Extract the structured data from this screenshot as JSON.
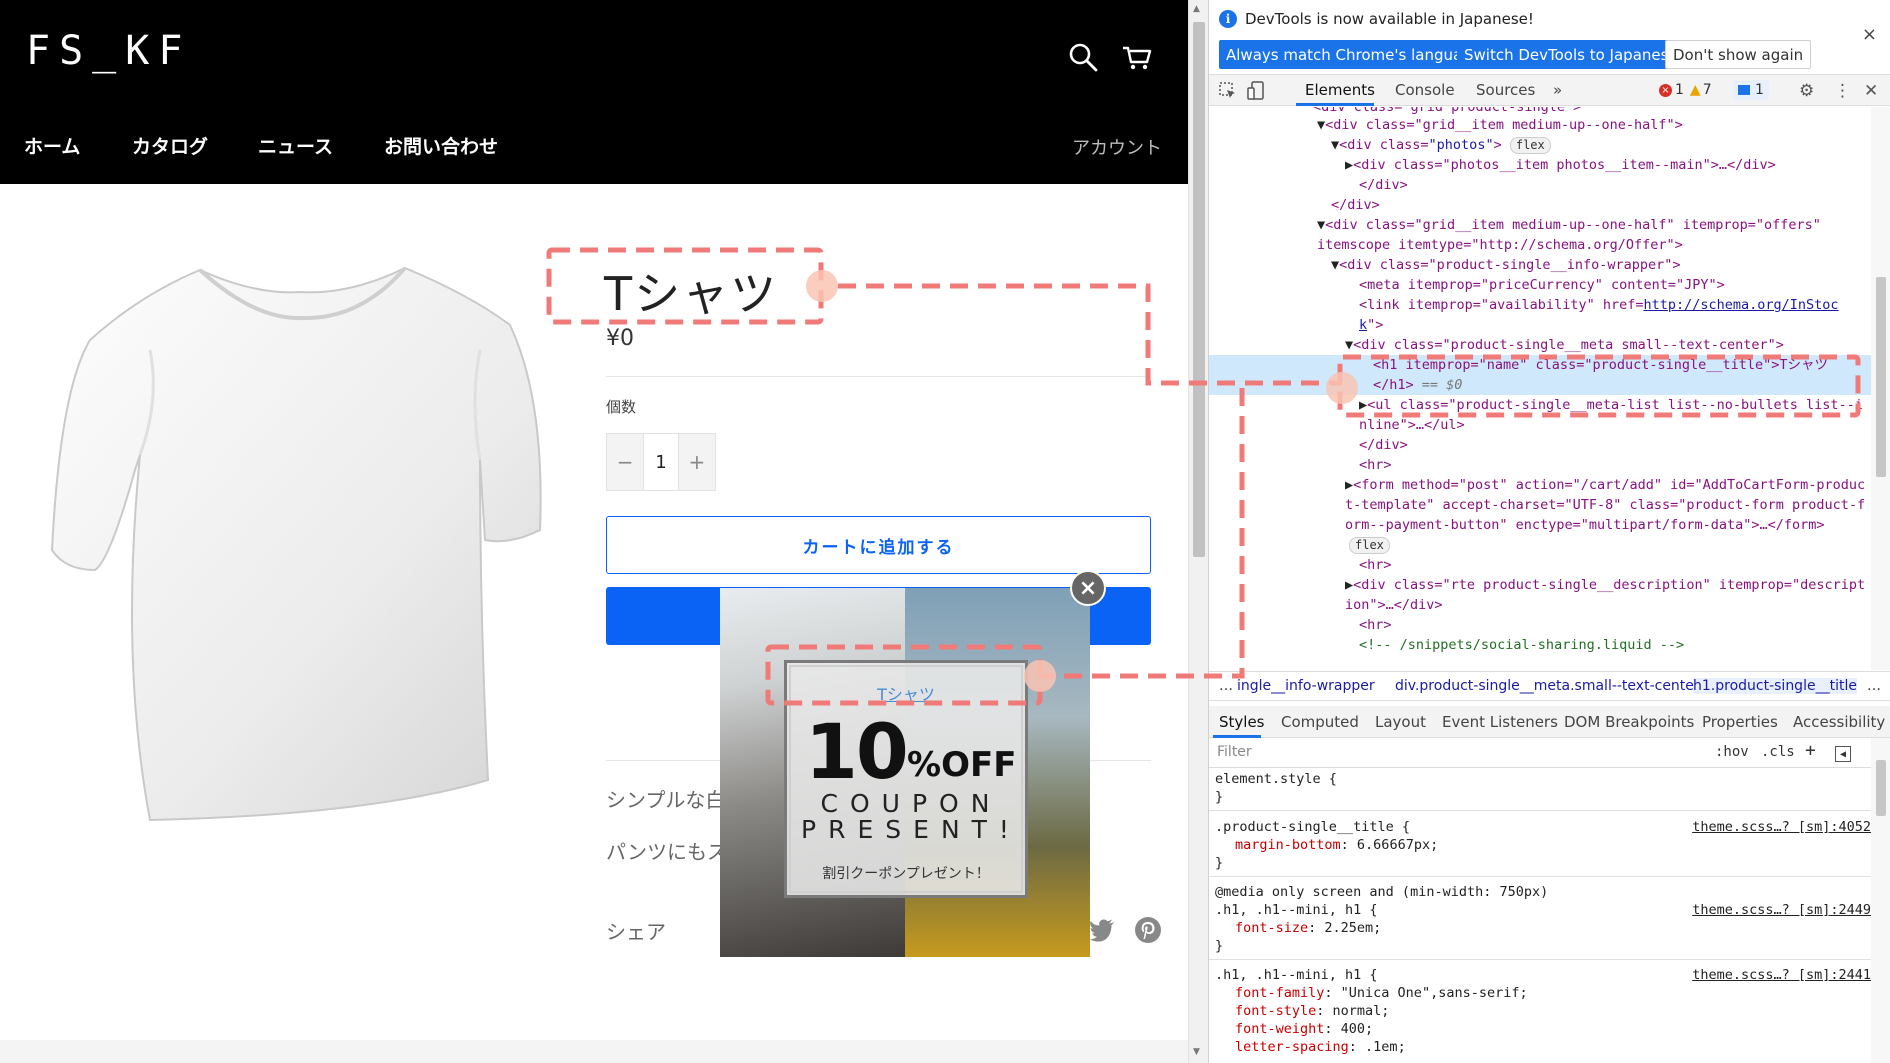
{
  "store": {
    "logo": "FS_KF",
    "nav": [
      "ホーム",
      "カタログ",
      "ニュース",
      "お問い合わせ"
    ],
    "account": "アカウント",
    "product": {
      "title": "Tシャツ",
      "price": "¥0",
      "qty_label": "個数",
      "qty_minus": "−",
      "qty_value": "1",
      "qty_plus": "+",
      "add_to_cart": "カートに追加する",
      "desc_1": "シンプルな白",
      "desc_2": "パンツにもス",
      "share": "シェア"
    },
    "popup": {
      "close": "×",
      "link": "Tシャツ",
      "big_number": "10",
      "off": "%OFF",
      "line1": "COUPON",
      "line2": "PRESENT!",
      "sub": "割引クーポンプレゼント！"
    }
  },
  "devtools": {
    "info_icon": "i",
    "info": "DevTools is now available in Japanese!",
    "btn_match": "Always match Chrome's language",
    "btn_switch": "Switch DevTools to Japanese",
    "btn_dont": "Don't show again",
    "close": "×",
    "tabs": [
      "Elements",
      "Console",
      "Sources",
      "»"
    ],
    "errors": "1",
    "warnings": "7",
    "messages": "1",
    "dom": {
      "l0": "<div class=\"grid__item medium-up--one-half\">",
      "l1_tag": "<div class=",
      "l1_val": "\"photos\"",
      "l1_pill": "flex",
      "l2": "<div class=\"photos__item photos__item--main\">…</div>",
      "l3": "</div>",
      "l4": "</div>",
      "l5a": "<div class=\"grid__item medium-up--one-half\" itemprop=\"offers\"",
      "l5b": "itemscope itemtype=\"http://schema.org/Offer\">",
      "l6": "<div class=\"product-single__info-wrapper\">",
      "l7": "<meta itemprop=\"priceCurrency\" content=\"JPY\">",
      "l8a": "<link itemprop=\"availability\" href=",
      "l8_link": "http://schema.org/InStoc",
      "l8b": "k",
      "l9": "<div class=\"product-single__meta small--text-center\">",
      "l10": "<h1 itemprop=\"name\" class=\"product-single__title\">Tシャツ",
      "l11": "</h1>",
      "l11_eq": "== $0",
      "l12a": "<ul class=\"product-single__meta-list list--no-bullets list--i",
      "l12b": "nline\">…</ul>",
      "l13": "</div>",
      "l14": "<hr>",
      "l15a": "<form method=\"post\" action=\"/cart/add\" id=\"AddToCartForm-produc",
      "l15b": "t-template\" accept-charset=\"UTF-8\" class=\"product-form product-f",
      "l15c": "orm--payment-button\" enctype=\"multipart/form-data\">…</form>",
      "l16_pill": "flex",
      "l17": "<hr>",
      "l18a": "<div class=\"rte product-single__description\" itemprop=\"descript",
      "l18b": "ion\">…</div>",
      "l19": "<hr>",
      "l20": "<!-- /snippets/social-sharing.liquid -->"
    },
    "breadcrumbs": [
      "…",
      "ingle__info-wrapper",
      "div.product-single__meta.small--text-center",
      "h1.product-single__title",
      "…"
    ],
    "style_tabs": [
      "Styles",
      "Computed",
      "Layout",
      "Event Listeners",
      "DOM Breakpoints",
      "Properties",
      "Accessibility"
    ],
    "filter_placeholder": "Filter",
    "filter_hov": ":hov",
    "filter_cls": ".cls",
    "styles": {
      "r1_sel": "element.style {",
      "r1_end": "}",
      "r2_sel": ".product-single__title {",
      "r2_src": "theme.scss…? [sm]:4052",
      "r2_prop": "margin-bottom",
      "r2_val": ": 6.66667px;",
      "r2_end": "}",
      "r3_media": "@media only screen and (min-width: 750px)",
      "r3_sel": ".h1, .h1--mini, h1 {",
      "r3_src": "theme.scss…? [sm]:2449",
      "r3_prop": "font-size",
      "r3_val": ": 2.25em;",
      "r3_end": "}",
      "r4_sel": ".h1, .h1--mini, h1 {",
      "r4_src": "theme.scss…? [sm]:2441",
      "r4_p1": "font-family",
      "r4_v1": ": \"Unica One\",sans-serif;",
      "r4_p2": "font-style",
      "r4_v2": ": normal;",
      "r4_p3": "font-weight",
      "r4_v3": ": 400;",
      "r4_p4": "letter-spacing",
      "r4_v4": ": .1em;"
    }
  },
  "colors": {
    "accent_blue": "#1a73e8",
    "buy_blue": "#0b63f6",
    "annotation": "#f07a78",
    "dom_selected": "#cfe8fc"
  }
}
